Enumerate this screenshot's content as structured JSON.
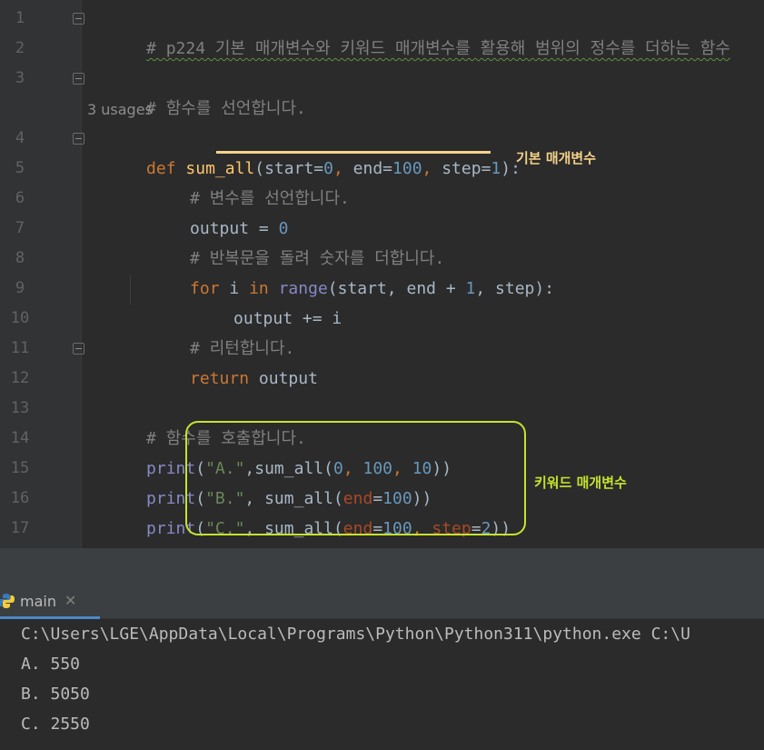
{
  "editor": {
    "line_numbers": [
      "1",
      "2",
      "3",
      "4",
      "5",
      "6",
      "7",
      "8",
      "9",
      "10",
      "11",
      "12",
      "13",
      "14",
      "15",
      "16",
      "17"
    ],
    "line1_comment": "# p224 기본 매개변수와 키워드 매개변수를 활용해 범위의 정수를 더하는 함수",
    "line3_comment": "# 함수를 선언합니다.",
    "usages": "3 usages",
    "line4": {
      "kw": "def",
      "fn": "sum_all",
      "open": "(",
      "p1": "start=",
      "v1": "0",
      "sep1": ", ",
      "p2": "end=",
      "v2": "100",
      "sep2": ", ",
      "p3": "step=",
      "v3": "1",
      "close": "):"
    },
    "line5_comment": "# 변수를 선언합니다.",
    "line6": {
      "name": "output = ",
      "val": "0"
    },
    "line7_comment": "# 반복문을 돌려 숫자를 더합니다.",
    "line8": {
      "kw_for": "for",
      "mid1": " i ",
      "kw_in": "in",
      "sp": " ",
      "builtin": "range",
      "mid2": "(start, end + ",
      "num": "1",
      "mid3": ", step):"
    },
    "line9": "output += i",
    "line10_comment": "# 리턴합니다.",
    "line11": {
      "kw": "return",
      "rest": " output"
    },
    "line13_comment": "# 함수를 호출합니다.",
    "line14": {
      "builtin": "print",
      "open": "(",
      "str": "\"A.\"",
      "mid": ",sum_all(",
      "n1": "0",
      "s1": ", ",
      "n2": "100",
      "s2": ", ",
      "n3": "10",
      "close": "))"
    },
    "line15": {
      "builtin": "print",
      "open": "(",
      "str": "\"B.\"",
      "mid": ", sum_all(",
      "param": "end",
      "eq": "=",
      "n1": "100",
      "close": "))"
    },
    "line16": {
      "builtin": "print",
      "open": "(",
      "str": "\"C.\"",
      "mid": ", sum_all(",
      "param1": "end",
      "eq1": "=",
      "n1": "100",
      "sep": ", ",
      "param2": "step",
      "eq2": "=",
      "n2": "2",
      "close": "))"
    }
  },
  "annotations": {
    "default_params_label": "기본 매개변수",
    "keyword_params_label": "키워드 매개변수",
    "default_color": "#f4d28a",
    "keyword_color": "#c6e32c"
  },
  "run_panel": {
    "tab_label": "main",
    "close_glyph": "✕",
    "output_lines": [
      "C:\\Users\\LGE\\AppData\\Local\\Programs\\Python\\Python311\\python.exe C:\\U",
      "A. 550",
      "B. 5050",
      "C. 2550"
    ]
  }
}
